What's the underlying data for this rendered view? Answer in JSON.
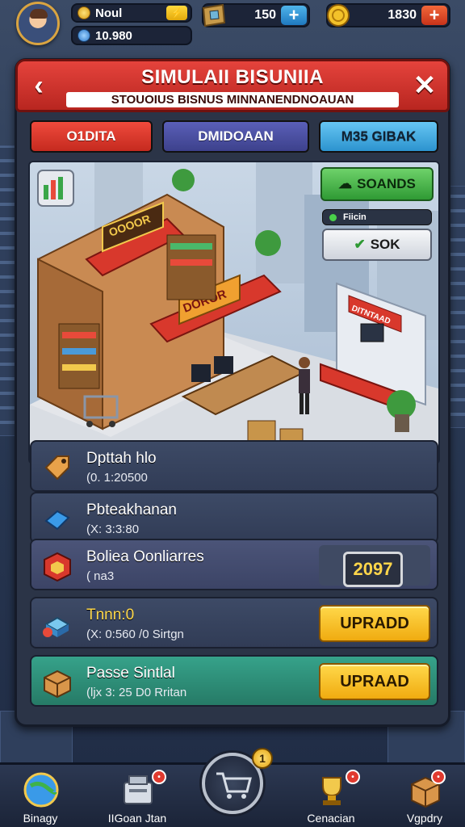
{
  "player": {
    "name": "Noul",
    "cash": "10.980",
    "gems": "150",
    "coins": "1830"
  },
  "header": {
    "title": "SIMULAII BISUNIIA",
    "subtitle": "STOUOIUS BISNUS MINNANENDNOAUAN"
  },
  "tabs": [
    {
      "label": "O1DITA",
      "color": "#d8382c"
    },
    {
      "label": "DMIDOAAN",
      "color": "#4a4fa0"
    },
    {
      "label": "M35 GIBAK",
      "color": "#3aa6dc"
    }
  ],
  "scene": {
    "sign_main": "OOOOR",
    "sign_shop": "DOROR",
    "sign_right": "DITNTAAD",
    "btn_sounds": "SOANDS",
    "status_text": "Fiicin",
    "btn_sok": "SOK"
  },
  "rows": [
    {
      "name": "Dpttah hlo",
      "desc": "(0. 1:20500",
      "action": null,
      "icon": "price-tag-icon"
    },
    {
      "name": "Pbteakhanan",
      "desc": "(X: 3:3:80",
      "action": null,
      "icon": "blue-gem-icon"
    },
    {
      "name": "Boliea Oonliarres",
      "desc": "( na3",
      "action": "2097",
      "icon": "cube-icon"
    },
    {
      "name": "Tnnn:0",
      "desc": "(X: 0:560 /0 Sirtgn",
      "action": "UPRADD",
      "icon": "box-stack-icon"
    },
    {
      "name": "Passe Sintlal",
      "desc": "(ljx 3: 25 D0 Rritan",
      "action": "UPRAAD",
      "icon": "crate-icon"
    }
  ],
  "nav": [
    {
      "label": "Binagy",
      "badge": ""
    },
    {
      "label": "IIGoan Jtan",
      "badge": "•"
    },
    {
      "label": "",
      "badge": "1"
    },
    {
      "label": "Cenacian",
      "badge": "•"
    },
    {
      "label": "Vgpdry",
      "badge": "•"
    }
  ],
  "colors": {
    "header_red": "#d8382c",
    "upgrade_yellow": "#f5c22a",
    "panel_dark": "#2b3447",
    "row_green": "#2f8f7a"
  }
}
